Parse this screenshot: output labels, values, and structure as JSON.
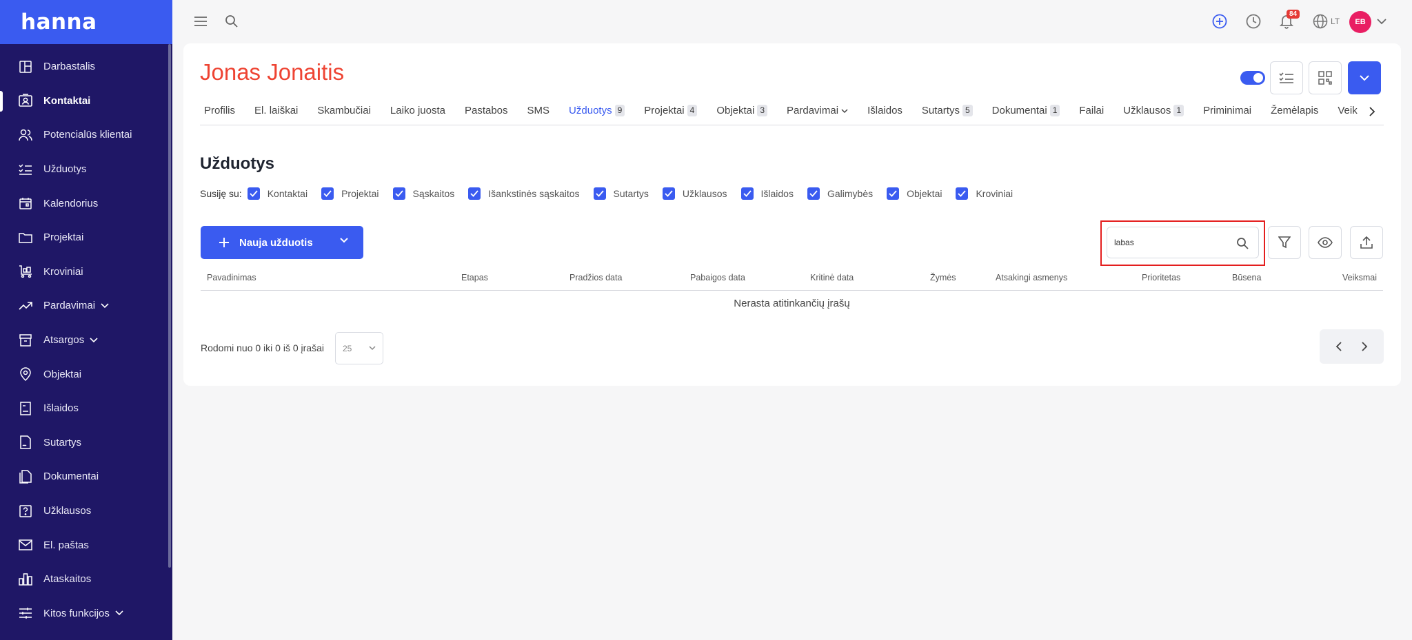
{
  "app": {
    "logo": "hanna"
  },
  "sidebar": {
    "items": [
      {
        "label": "Darbastalis",
        "icon": "dashboard-icon"
      },
      {
        "label": "Kontaktai",
        "icon": "contact-card-icon",
        "active": true
      },
      {
        "label": "Potencialūs klientai",
        "icon": "users-icon"
      },
      {
        "label": "Užduotys",
        "icon": "checklist-icon"
      },
      {
        "label": "Kalendorius",
        "icon": "calendar-icon"
      },
      {
        "label": "Projektai",
        "icon": "folder-icon"
      },
      {
        "label": "Kroviniai",
        "icon": "cart-icon"
      },
      {
        "label": "Pardavimai",
        "icon": "trend-icon",
        "expandable": true
      },
      {
        "label": "Atsargos",
        "icon": "archive-icon",
        "expandable": true
      },
      {
        "label": "Objektai",
        "icon": "map-pin-icon"
      },
      {
        "label": "Išlaidos",
        "icon": "receipt-icon"
      },
      {
        "label": "Sutartys",
        "icon": "contract-icon"
      },
      {
        "label": "Dokumentai",
        "icon": "documents-icon"
      },
      {
        "label": "Užklausos",
        "icon": "question-icon"
      },
      {
        "label": "El. paštas",
        "icon": "mail-icon"
      },
      {
        "label": "Ataskaitos",
        "icon": "bar-chart-icon"
      },
      {
        "label": "Kitos funkcijos",
        "icon": "sliders-icon",
        "expandable": true
      }
    ]
  },
  "topbar": {
    "notifications_count": "84",
    "language": "LT",
    "avatar_initials": "EB"
  },
  "contact": {
    "name": "Jonas Jonaitis"
  },
  "tabs": [
    {
      "label": "Profilis",
      "count": ""
    },
    {
      "label": "El. laiškai",
      "count": ""
    },
    {
      "label": "Skambučiai",
      "count": ""
    },
    {
      "label": "Laiko juosta",
      "count": ""
    },
    {
      "label": "Pastabos",
      "count": ""
    },
    {
      "label": "SMS",
      "count": ""
    },
    {
      "label": "Užduotys",
      "count": "9",
      "active": true
    },
    {
      "label": "Projektai",
      "count": "4"
    },
    {
      "label": "Objektai",
      "count": "3"
    },
    {
      "label": "Pardavimai",
      "count": "",
      "dropdown": true
    },
    {
      "label": "Išlaidos",
      "count": ""
    },
    {
      "label": "Sutartys",
      "count": "5"
    },
    {
      "label": "Dokumentai",
      "count": "1"
    },
    {
      "label": "Failai",
      "count": ""
    },
    {
      "label": "Užklausos",
      "count": "1"
    },
    {
      "label": "Priminimai",
      "count": ""
    },
    {
      "label": "Žemėlapis",
      "count": ""
    },
    {
      "label": "Veik",
      "count": ""
    }
  ],
  "tasks": {
    "title": "Užduotys",
    "related_label": "Susiję su:",
    "related": [
      {
        "label": "Kontaktai",
        "checked": true
      },
      {
        "label": "Projektai",
        "checked": true
      },
      {
        "label": "Sąskaitos",
        "checked": true
      },
      {
        "label": "Išankstinės sąskaitos",
        "checked": true
      },
      {
        "label": "Sutartys",
        "checked": true
      },
      {
        "label": "Užklausos",
        "checked": true
      },
      {
        "label": "Išlaidos",
        "checked": true
      },
      {
        "label": "Galimybės",
        "checked": true
      },
      {
        "label": "Objektai",
        "checked": true
      },
      {
        "label": "Kroviniai",
        "checked": true
      }
    ],
    "new_button": "Nauja užduotis",
    "search_value": "labas",
    "columns": [
      "Pavadinimas",
      "Etapas",
      "Pradžios data",
      "Pabaigos data",
      "Kritinė data",
      "Žymės",
      "Atsakingi asmenys",
      "Prioritetas",
      "Būsena",
      "Veiksmai"
    ],
    "empty_message": "Nerasta atitinkančių įrašų",
    "footer_info": "Rodomi nuo 0 iki 0 iš 0 įrašai",
    "page_size": "25"
  },
  "colors": {
    "accent": "#3a5bf0",
    "sidebar": "#1f1766",
    "title": "#ee4433",
    "highlight": "#e41e1e"
  }
}
